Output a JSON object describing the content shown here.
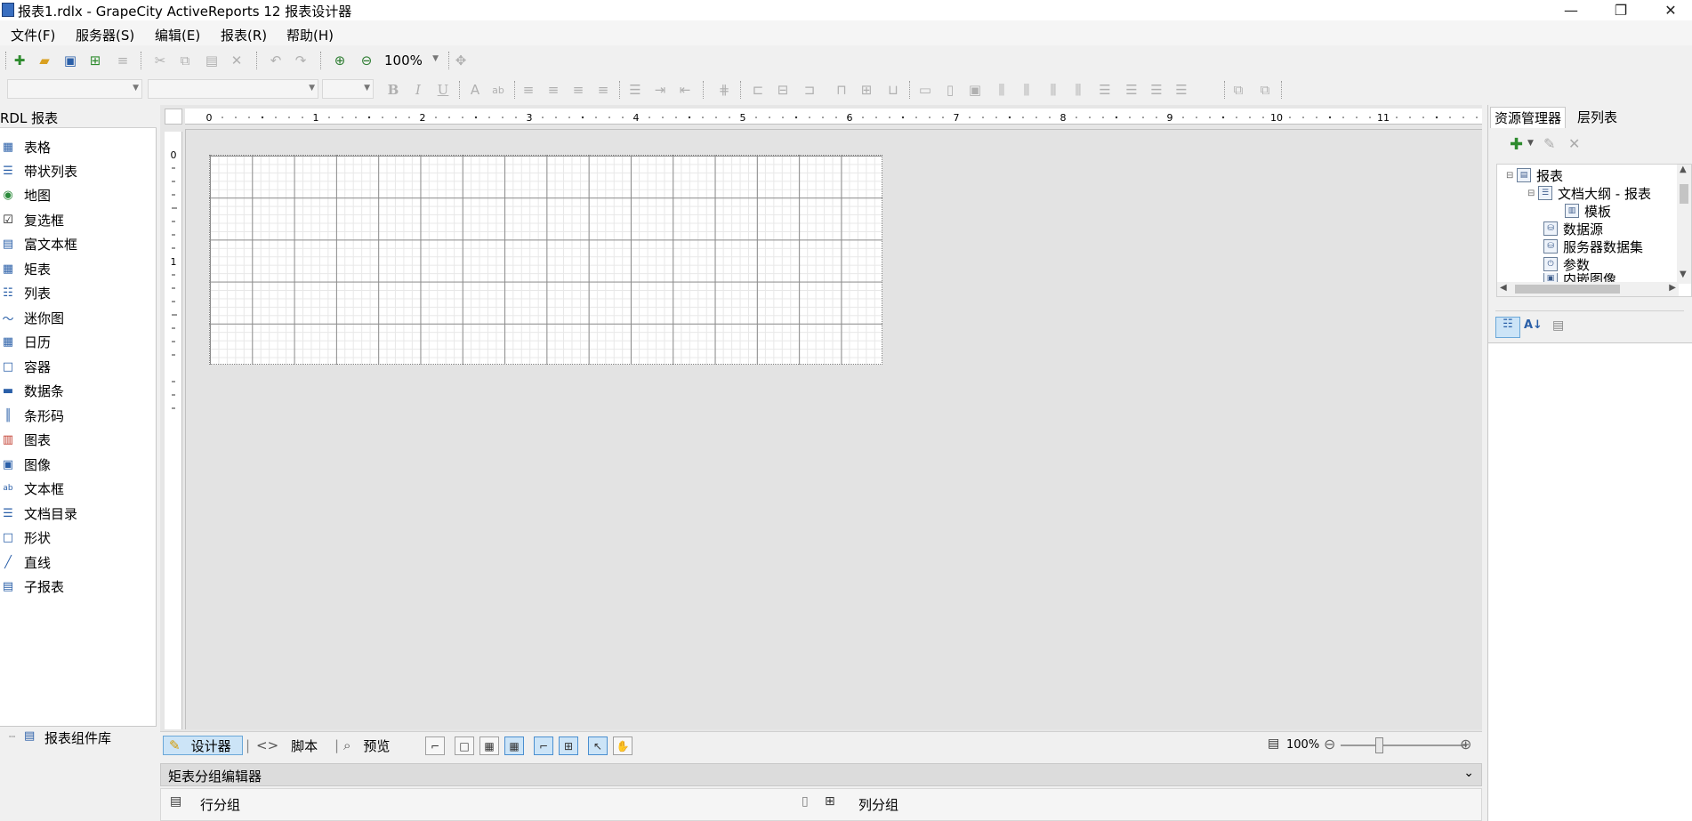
{
  "window": {
    "title": "报表1.rdlx - GrapeCity ActiveReports 12 报表设计器",
    "controls": [
      "—",
      "❐",
      "✕"
    ]
  },
  "menu": [
    "文件(F)",
    "服务器(S)",
    "编辑(E)",
    "报表(R)",
    "帮助(H)"
  ],
  "toolbar": {
    "zoom": "100%"
  },
  "toolbox": {
    "header": "RDL 报表",
    "items": [
      {
        "label": "表格",
        "icon": "table-icon"
      },
      {
        "label": "带状列表",
        "icon": "banded-list-icon"
      },
      {
        "label": "地图",
        "icon": "map-icon"
      },
      {
        "label": "复选框",
        "icon": "checkbox-icon"
      },
      {
        "label": "富文本框",
        "icon": "rich-textbox-icon"
      },
      {
        "label": "矩表",
        "icon": "matrix-icon"
      },
      {
        "label": "列表",
        "icon": "list-icon"
      },
      {
        "label": "迷你图",
        "icon": "sparkline-icon"
      },
      {
        "label": "日历",
        "icon": "calendar-icon"
      },
      {
        "label": "容器",
        "icon": "container-icon"
      },
      {
        "label": "数据条",
        "icon": "databar-icon"
      },
      {
        "label": "条形码",
        "icon": "barcode-icon"
      },
      {
        "label": "图表",
        "icon": "chart-icon"
      },
      {
        "label": "图像",
        "icon": "image-icon"
      },
      {
        "label": "文本框",
        "icon": "textbox-icon"
      },
      {
        "label": "文档目录",
        "icon": "toc-icon"
      },
      {
        "label": "形状",
        "icon": "shape-icon"
      },
      {
        "label": "直线",
        "icon": "line-icon"
      },
      {
        "label": "子报表",
        "icon": "subreport-icon"
      }
    ],
    "footer": "报表组件库"
  },
  "ruler": {
    "h_marks": [
      "0",
      "1",
      "2",
      "3",
      "4",
      "5",
      "6",
      "7",
      "8",
      "9",
      "10",
      "11"
    ],
    "v_marks": [
      "0",
      "1"
    ]
  },
  "bottombar": {
    "designer": "设计器",
    "script": "脚本",
    "preview": "预览",
    "zoom": "100%"
  },
  "matrix_editor": {
    "title": "矩表分组编辑器",
    "row_groups": "行分组",
    "column_groups": "列分组"
  },
  "right_panel": {
    "tabs": [
      "资源管理器",
      "层列表"
    ],
    "tree": [
      {
        "label": "报表",
        "level": 0
      },
      {
        "label": "文档大纲 - 报表",
        "level": 1
      },
      {
        "label": "模板",
        "level": 2
      },
      {
        "label": "数据源",
        "level": 1
      },
      {
        "label": "服务器数据集",
        "level": 1
      },
      {
        "label": "参数",
        "level": 1
      },
      {
        "label": "内嵌图像",
        "level": 1
      }
    ]
  }
}
